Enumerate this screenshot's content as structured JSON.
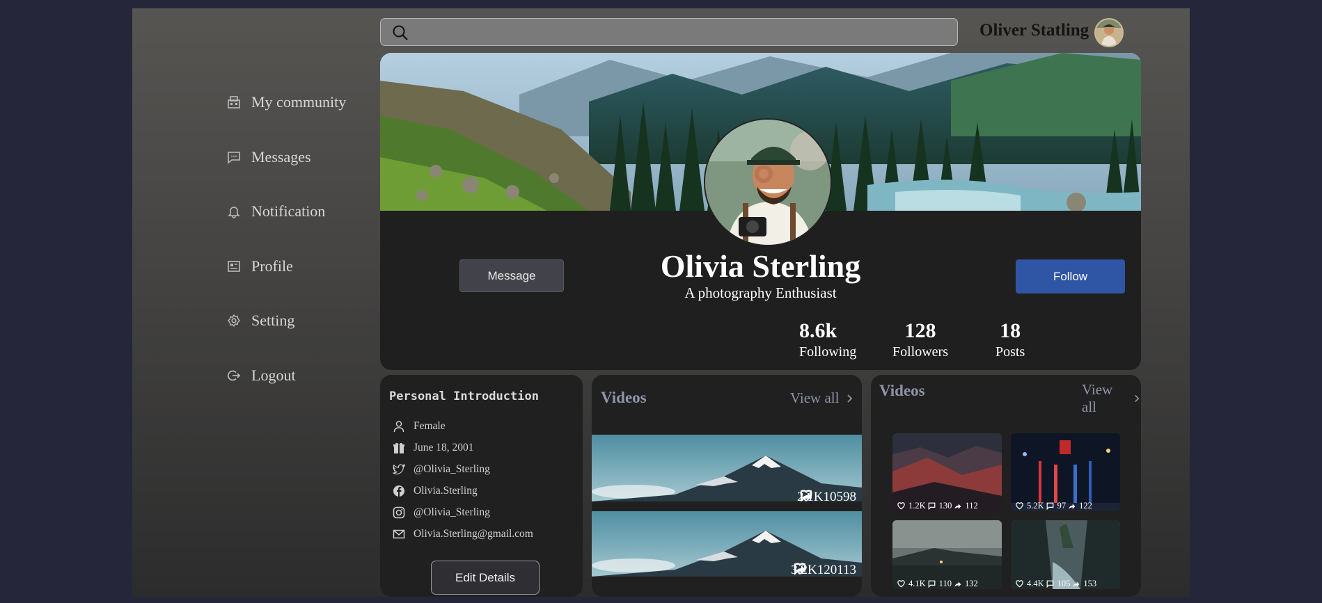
{
  "search": {
    "placeholder": "",
    "value": ""
  },
  "user": {
    "name": "Oliver Statling"
  },
  "sidebar": {
    "items": [
      {
        "label": "My community",
        "icon": "community-icon"
      },
      {
        "label": "Messages",
        "icon": "messages-icon"
      },
      {
        "label": "Notification",
        "icon": "bell-icon"
      },
      {
        "label": "Profile",
        "icon": "profile-card-icon"
      },
      {
        "label": "Setting",
        "icon": "gear-icon"
      },
      {
        "label": "Logout",
        "icon": "logout-icon"
      }
    ]
  },
  "profile": {
    "name": "Olivia Sterling",
    "tagline": "A photography Enthusiast",
    "message_label": "Message",
    "follow_label": "Follow",
    "stats": [
      {
        "value": "8.6k",
        "label": "Following"
      },
      {
        "value": "128",
        "label": "Followers"
      },
      {
        "value": "18",
        "label": "Posts"
      }
    ]
  },
  "intro": {
    "title": "Personal Introduction",
    "items": [
      {
        "icon": "person-icon",
        "text": "Female"
      },
      {
        "icon": "gift-icon",
        "text": "June 18, 2001"
      },
      {
        "icon": "twitter-icon",
        "text": "@Olivia_Sterling"
      },
      {
        "icon": "facebook-icon",
        "text": "Olivia.Sterling"
      },
      {
        "icon": "instagram-icon",
        "text": "@Olivia_Sterling"
      },
      {
        "icon": "mail-icon",
        "text": "Olivia.Sterling@gmail.com"
      }
    ],
    "edit_label": "Edit Details"
  },
  "videos_left": {
    "title": "Videos",
    "view_all": "View all",
    "items": [
      {
        "likes": "2.1K",
        "comments": "105",
        "shares": "98"
      },
      {
        "likes": "3.2K",
        "comments": "120",
        "shares": "113"
      }
    ]
  },
  "videos_right": {
    "title": "Videos",
    "view_all": "View all",
    "items": [
      {
        "likes": "1.2K",
        "comments": "130",
        "shares": "112"
      },
      {
        "likes": "5.2K",
        "comments": "97",
        "shares": "122"
      },
      {
        "likes": "4.1K",
        "comments": "110",
        "shares": "132"
      },
      {
        "likes": "4.4K",
        "comments": "105",
        "shares": "153"
      }
    ]
  },
  "colors": {
    "page_bg": "#26263a",
    "card_bg": "#1f1f1f",
    "follow_button": "#2f55a5",
    "muted_text": "#8f95a7"
  }
}
